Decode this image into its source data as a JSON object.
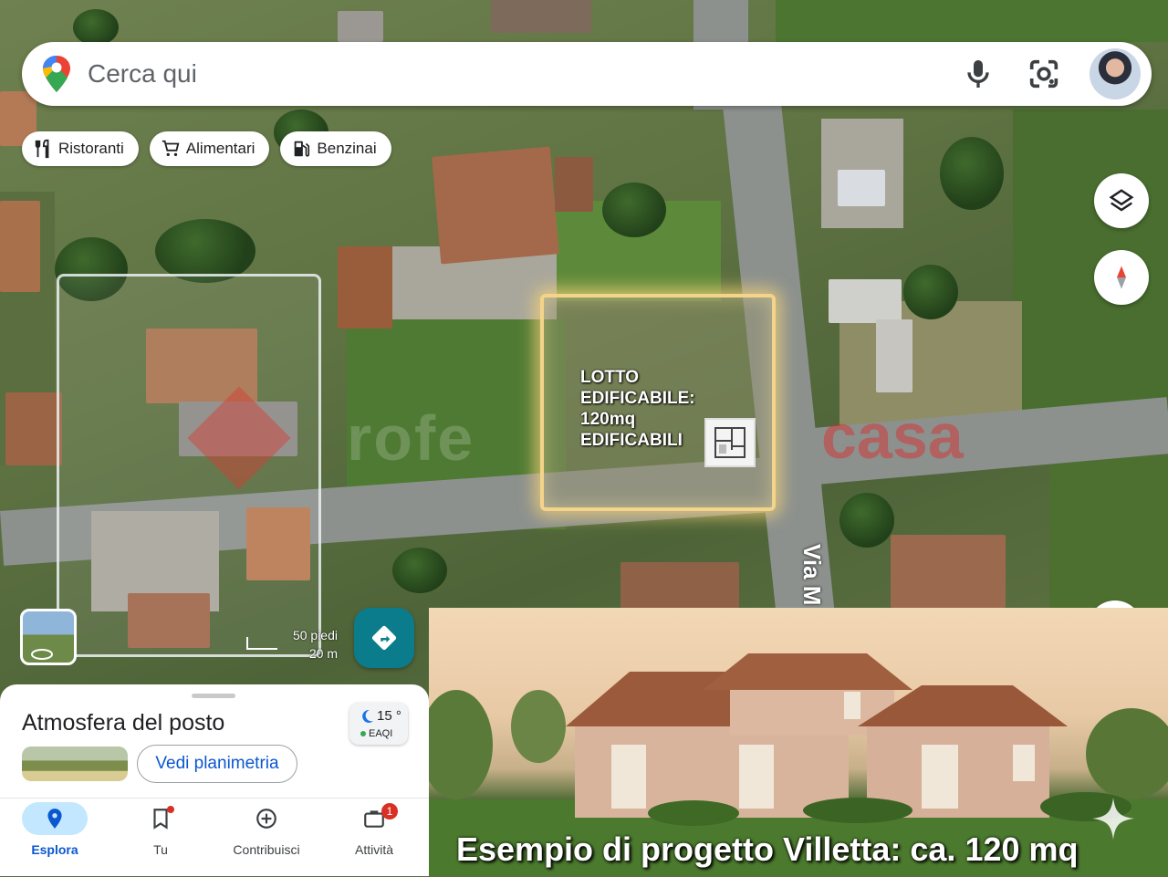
{
  "search": {
    "placeholder": "Cerca qui"
  },
  "chips": [
    {
      "label": "Ristoranti",
      "icon": "fork-knife-icon"
    },
    {
      "label": "Alimentari",
      "icon": "cart-icon"
    },
    {
      "label": "Benzinai",
      "icon": "fuel-pump-icon"
    }
  ],
  "map": {
    "lot_label": "LOTTO\nEDIFICABILE:\n120mq\nEDIFICABILI",
    "street_label": "Via M",
    "scale_top": "50 piedi",
    "scale_bottom": "20 m",
    "watermark_left": "rofe",
    "watermark_right": "casa"
  },
  "sheet": {
    "title": "Atmosfera del posto",
    "weather_temp": "15 °",
    "weather_aqi": "EAQI",
    "vedi_label": "Vedi planimetria"
  },
  "nav": {
    "esplora": "Esplora",
    "tu": "Tu",
    "contribuisci": "Contribuisci",
    "attivita": "Attività",
    "attivita_badge": "1"
  },
  "render": {
    "caption": "Esempio di progetto Villetta: ca. 120 mq"
  },
  "colors": {
    "accent": "#0b7c8c",
    "link": "#0b57d0",
    "lot_glow": "#f4d48a",
    "badge": "#d93025"
  }
}
